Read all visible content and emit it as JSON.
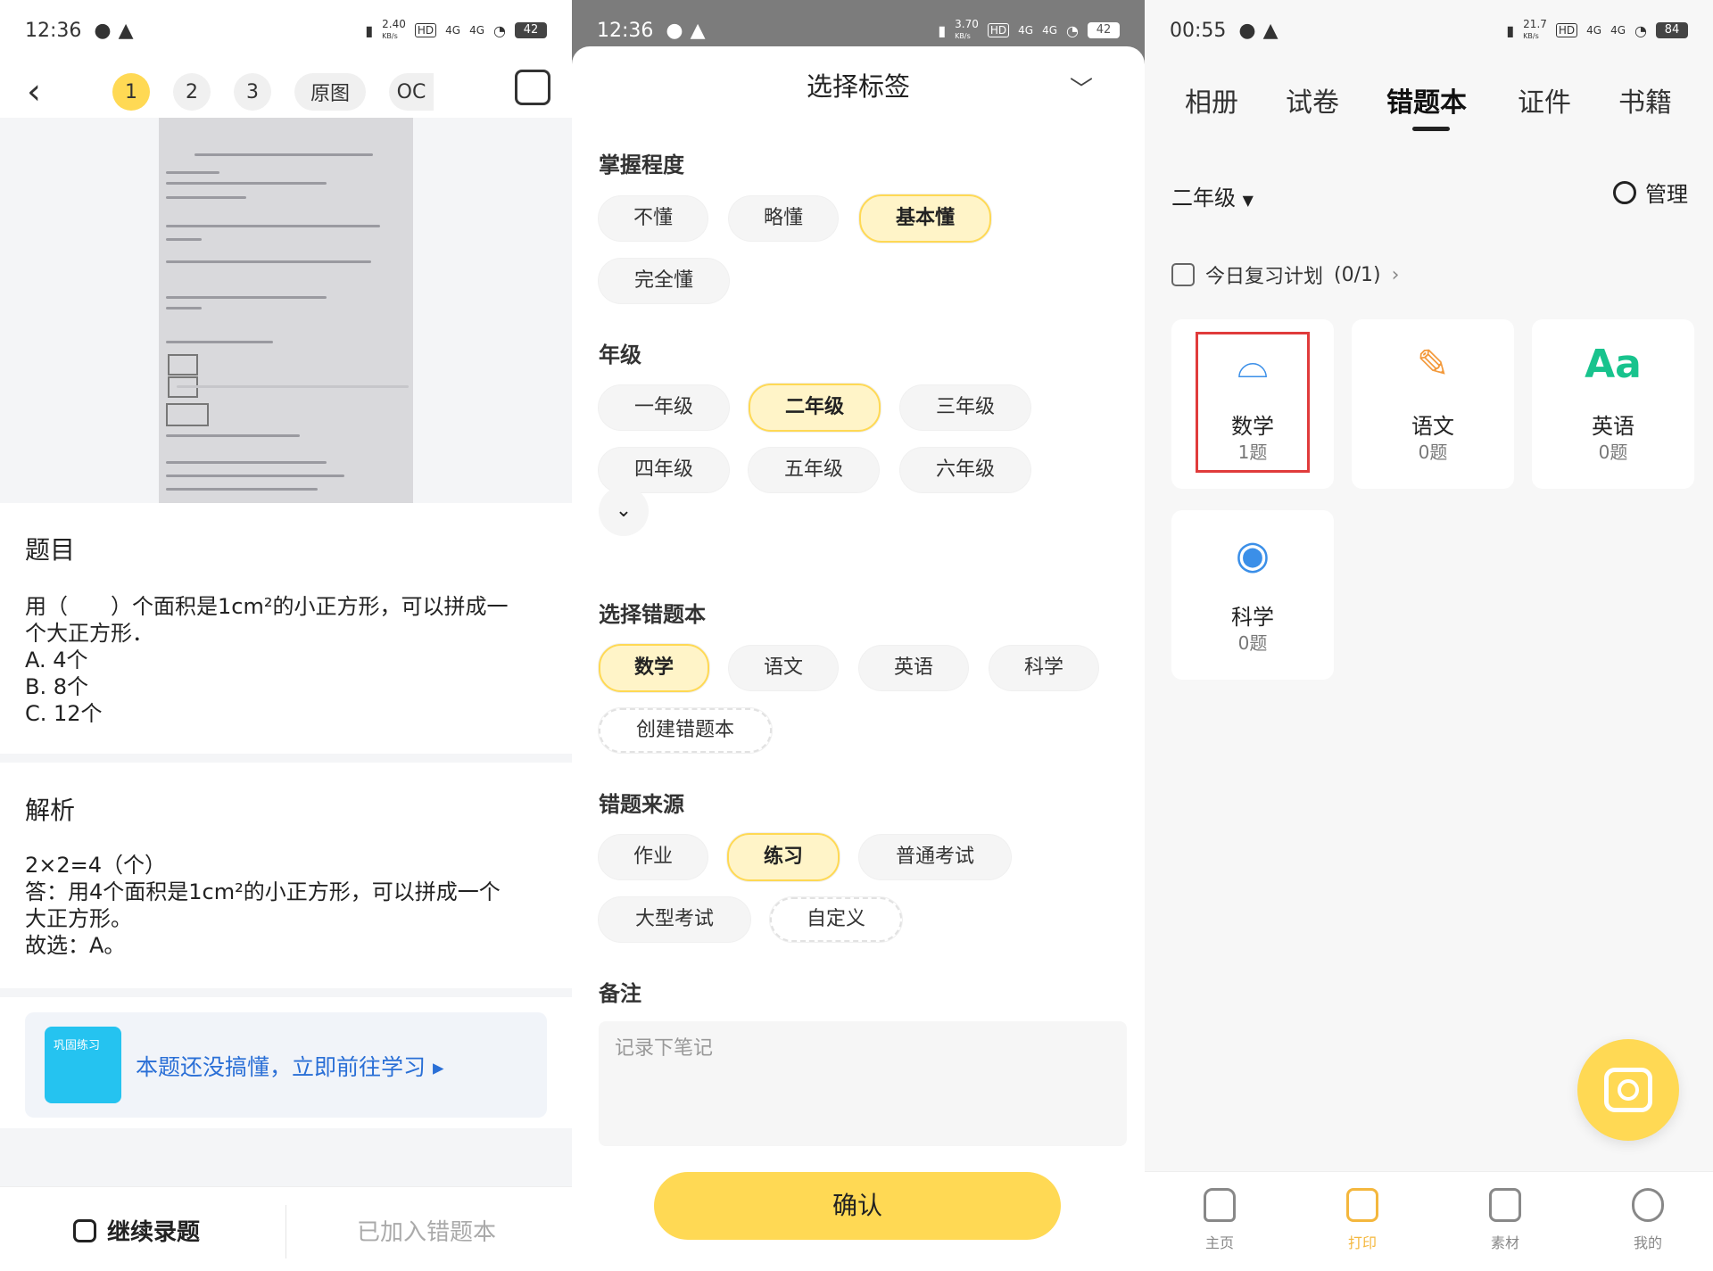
{
  "panel1": {
    "status": {
      "time": "12:36",
      "speed": "2.40",
      "speed_unit": "KB/s",
      "hd": "HD",
      "net1": "4G",
      "net2": "4G",
      "battery": "42"
    },
    "pages": [
      "1",
      "2",
      "3"
    ],
    "original_label": "原图",
    "ocr_label": "OC",
    "question_heading": "题目",
    "question_lines": [
      "用（　　）个面积是1cm²的小正方形，可以拼成一",
      "个大正方形．",
      "A. 4个",
      "B. 8个",
      "C. 12个"
    ],
    "analysis_heading": "解析",
    "analysis_lines": [
      "2×2=4（个）",
      "答：用4个面积是1cm²的小正方形，可以拼成一个",
      "大正方形。",
      "故选：A。"
    ],
    "promo_badge": "巩固练习",
    "promo_text": "本题还没搞懂，立即前往学习",
    "continue_label": "继续录题",
    "added_label": "已加入错题本"
  },
  "panel2": {
    "status": {
      "time": "12:36",
      "speed": "3.70",
      "speed_unit": "KB/s",
      "hd": "HD",
      "net1": "4G",
      "net2": "4G",
      "battery": "42"
    },
    "title": "选择标签",
    "mastery_label": "掌握程度",
    "mastery": [
      "不懂",
      "略懂",
      "基本懂",
      "完全懂"
    ],
    "grade_label": "年级",
    "grades": [
      "一年级",
      "二年级",
      "三年级",
      "四年级",
      "五年级",
      "六年级"
    ],
    "book_label": "选择错题本",
    "books": [
      "数学",
      "语文",
      "英语",
      "科学"
    ],
    "create_book": "创建错题本",
    "source_label": "错题来源",
    "sources": [
      "作业",
      "练习",
      "普通考试",
      "大型考试",
      "自定义"
    ],
    "notes_label": "备注",
    "notes_placeholder": "记录下笔记",
    "confirm_label": "确认"
  },
  "panel3": {
    "status": {
      "time": "00:55",
      "speed": "21.7",
      "speed_unit": "KB/s",
      "hd": "HD",
      "net1": "4G",
      "net2": "4G",
      "battery": "84"
    },
    "tabs": [
      "相册",
      "试卷",
      "错题本",
      "证件",
      "书籍"
    ],
    "grade_select": "二年级",
    "manage_label": "管理",
    "plan_text": "今日复习计划",
    "plan_count": "(0/1)",
    "subjects": [
      {
        "name": "数学",
        "count": "1题",
        "color": "#3b8fe8"
      },
      {
        "name": "语文",
        "count": "0题",
        "color": "#f39a3c"
      },
      {
        "name": "英语",
        "count": "0题",
        "color": "#18c38d"
      },
      {
        "name": "科学",
        "count": "0题",
        "color": "#3b8fe8"
      }
    ],
    "nav": [
      "主页",
      "打印",
      "素材",
      "我的"
    ]
  }
}
